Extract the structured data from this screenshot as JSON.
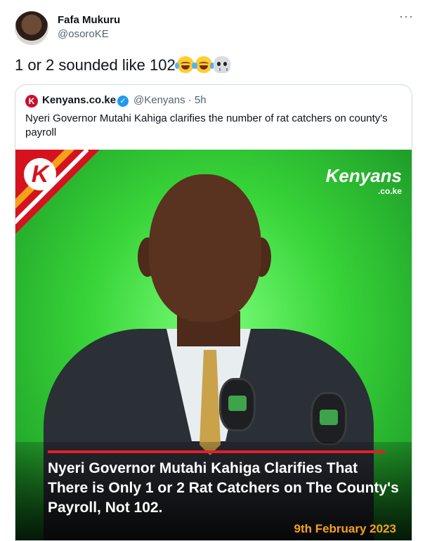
{
  "author": {
    "name": "Fafa Mukuru",
    "handle": "@osoroKE"
  },
  "menu_icon": "more-dots-icon",
  "tweet": {
    "text": "1 or 2 sounded like 102",
    "emojis": [
      "face-with-tears-of-joy",
      "face-with-tears-of-joy",
      "skull"
    ]
  },
  "quoted": {
    "name": "Kenyans.co.ke",
    "verified": true,
    "handle_time": "@Kenyans · 5h",
    "text": "Nyeri Governor Mutahi Kahiga clarifies the number of rat catchers on county's payroll",
    "image": {
      "watermark": "Kenyans",
      "watermark_sub": ".co.ke",
      "headline": "Nyeri Governor Mutahi Kahiga Clarifies That There is Only 1 or 2 Rat Catchers on The County's Payroll, Not 102.",
      "date": "9th February 2023",
      "colors": {
        "background": "#38d438",
        "brand_red": "#d7121f",
        "accent_orange": "#f4a21a"
      }
    }
  }
}
